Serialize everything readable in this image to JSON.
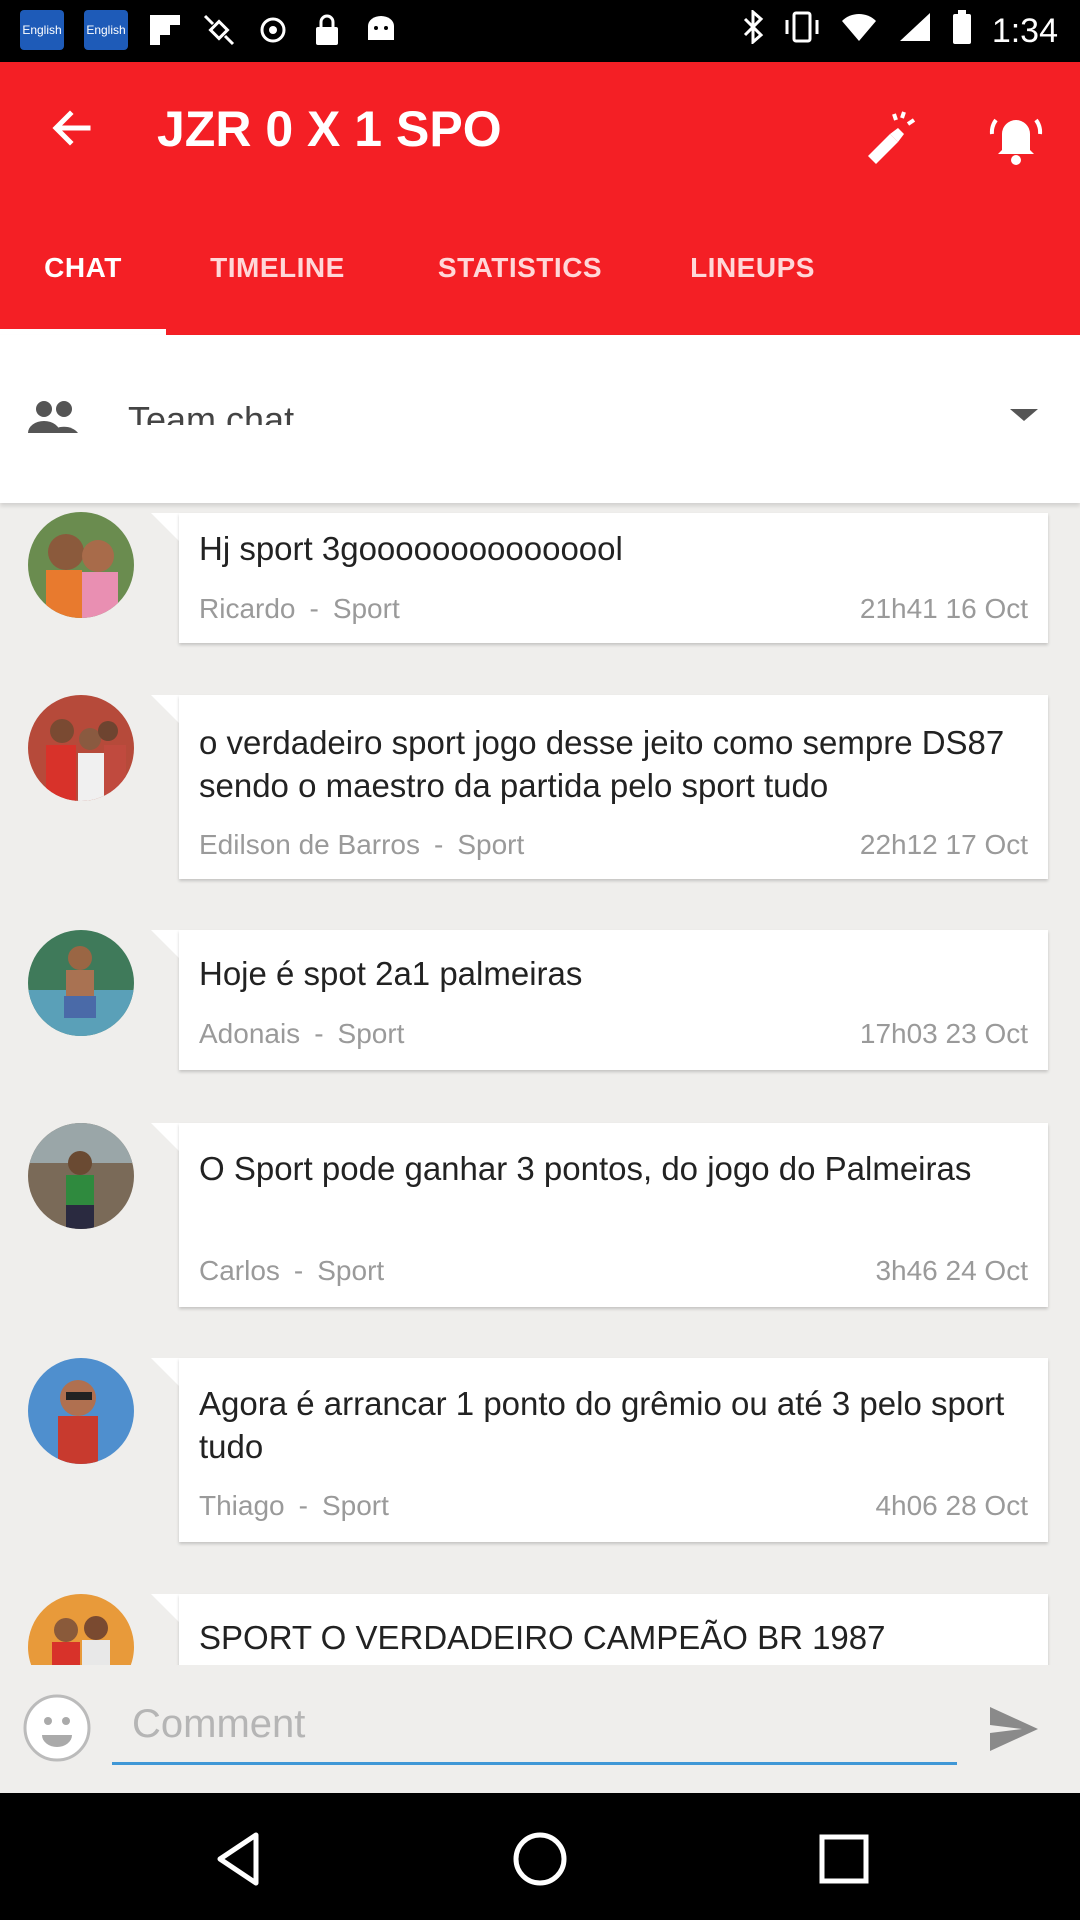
{
  "status_bar": {
    "badges": [
      "English",
      "English"
    ],
    "time": "1:34"
  },
  "header": {
    "title": "JZR 0 X 1 SPO",
    "tabs": [
      {
        "label": "CHAT",
        "active": true
      },
      {
        "label": "TIMELINE",
        "active": false
      },
      {
        "label": "STATISTICS",
        "active": false
      },
      {
        "label": "LINEUPS",
        "active": false
      }
    ],
    "accent_color": "#f41f25"
  },
  "room": {
    "label": "Team chat"
  },
  "messages": [
    {
      "text": "Hj sport 3gooooooooooooool",
      "author": "Ricardo",
      "team": "Sport",
      "time": "21h41 16 Oct"
    },
    {
      "text": "o verdadeiro sport jogo desse jeito como sempre DS87 sendo o maestro da partida pelo sport tudo",
      "author": "Edilson de Barros",
      "team": "Sport",
      "time": "22h12 17 Oct"
    },
    {
      "text": "Hoje é spot 2a1 palmeiras",
      "author": "Adonais",
      "team": "Sport",
      "time": "17h03 23 Oct"
    },
    {
      "text": "O Sport pode ganhar 3 pontos, do jogo do Palmeiras",
      "author": "Carlos",
      "team": "Sport",
      "time": "3h46 24 Oct"
    },
    {
      "text": "Agora é arrancar 1 ponto do grêmio ou até 3 pelo sport tudo",
      "author": "Thiago",
      "team": "Sport",
      "time": "4h06 28 Oct"
    },
    {
      "text": "SPORT O VERDADEIRO CAMPEÃO BR 1987",
      "author": "",
      "team": "",
      "time": ""
    }
  ],
  "composer": {
    "placeholder": "Comment"
  },
  "separator": "-"
}
